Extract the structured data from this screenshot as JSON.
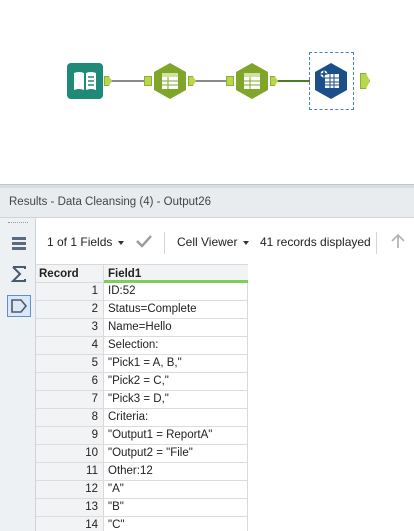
{
  "canvas": {
    "tools": [
      {
        "name": "book-input-icon",
        "color": "#1f8a78"
      },
      {
        "name": "formula-icon-1",
        "color": "#7fa52b"
      },
      {
        "name": "formula-icon-2",
        "color": "#7fa52b"
      },
      {
        "name": "browse-output-icon",
        "color": "#1b4f8a"
      }
    ]
  },
  "results": {
    "title": "Results - Data Cleansing (4) - Output26"
  },
  "toolbar": {
    "fields_label": "1 of 1 Fields",
    "cell_viewer_label": "Cell Viewer",
    "records_label": "41 records displayed",
    "icons": [
      "checkmark-icon",
      "up-arrow-icon"
    ]
  },
  "left_strip": {
    "icons": [
      "list-icon",
      "sum-icon",
      "tag-icon"
    ]
  },
  "grid": {
    "columns": [
      "Record",
      "Field1"
    ],
    "rows": [
      {
        "record": "1",
        "value": "ID:52"
      },
      {
        "record": "2",
        "value": "Status=Complete"
      },
      {
        "record": "3",
        "value": "Name=Hello"
      },
      {
        "record": "4",
        "value": "Selection:"
      },
      {
        "record": "5",
        "value": "\"Pick1 = A, B,\""
      },
      {
        "record": "6",
        "value": "\"Pick2 = C,\""
      },
      {
        "record": "7",
        "value": "\"Pick3 = D,\""
      },
      {
        "record": "8",
        "value": "Criteria:"
      },
      {
        "record": "9",
        "value": "\"Output1 = ReportA\""
      },
      {
        "record": "10",
        "value": "\"Output2 = \"File\""
      },
      {
        "record": "11",
        "value": "Other:12"
      },
      {
        "record": "12",
        "value": "\"A\""
      },
      {
        "record": "13",
        "value": "\"B\""
      },
      {
        "record": "14",
        "value": "\"C\""
      }
    ]
  }
}
